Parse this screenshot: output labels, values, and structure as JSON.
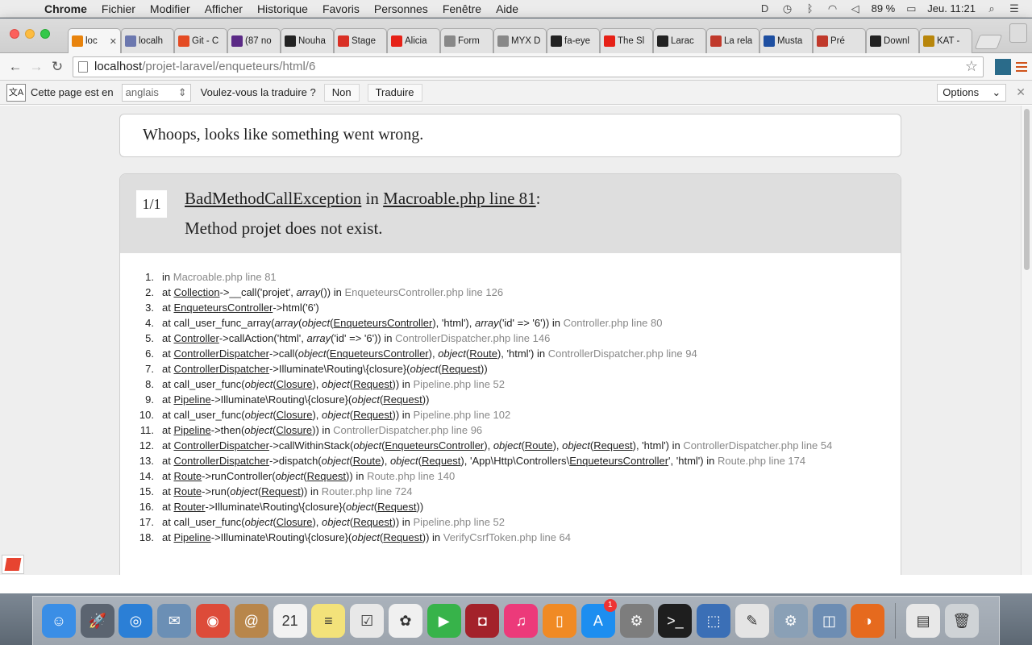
{
  "menubar": {
    "apple": "",
    "items": [
      "Chrome",
      "Fichier",
      "Modifier",
      "Afficher",
      "Historique",
      "Favoris",
      "Personnes",
      "Fenêtre",
      "Aide"
    ],
    "battery": "89 %",
    "clock": "Jeu. 11:21"
  },
  "tabs": [
    {
      "label": "loc",
      "color": "#e8830c",
      "active": true
    },
    {
      "label": "localh",
      "color": "#6c78af"
    },
    {
      "label": "Git - C",
      "color": "#e44b23"
    },
    {
      "label": "(87 no",
      "color": "#5b2a86"
    },
    {
      "label": "Nouha",
      "color": "#222222"
    },
    {
      "label": "Stage",
      "color": "#d93025"
    },
    {
      "label": "Alicia",
      "color": "#e62117"
    },
    {
      "label": "Form",
      "color": "#888888"
    },
    {
      "label": "MYX D",
      "color": "#888888"
    },
    {
      "label": "fa-eye",
      "color": "#222222"
    },
    {
      "label": "The Sl",
      "color": "#e62117"
    },
    {
      "label": "Larac",
      "color": "#222222"
    },
    {
      "label": "La rela",
      "color": "#c0392b"
    },
    {
      "label": "Musta",
      "color": "#1e4fa1"
    },
    {
      "label": "Pré",
      "color": "#c0392b"
    },
    {
      "label": "Downl",
      "color": "#222222"
    },
    {
      "label": "KAT -",
      "color": "#b8860b"
    }
  ],
  "address": {
    "host": "localhost",
    "path": "/projet-laravel/enqueteurs/html/6"
  },
  "translate": {
    "prefix": "Cette page est en",
    "language": "anglais",
    "question": "Voulez-vous la traduire ?",
    "no": "Non",
    "translate": "Traduire",
    "options": "Options"
  },
  "page": {
    "whoops": "Whoops, looks like something went wrong.",
    "counter": "1/1",
    "exception_class": "BadMethodCallException",
    "in_word": "in",
    "exception_file": "Macroable.php line 81",
    "colon": ":",
    "message": "Method projet does not exist."
  },
  "trace": [
    "in Macroable.php line 81",
    "at Collection->__call('projet', array()) in EnqueteursController.php line 126",
    "at EnqueteursController->html('6')",
    "at call_user_func_array(array(object(EnqueteursController), 'html'), array('id' => '6')) in Controller.php line 80",
    "at Controller->callAction('html', array('id' => '6')) in ControllerDispatcher.php line 146",
    "at ControllerDispatcher->call(object(EnqueteursController), object(Route), 'html') in ControllerDispatcher.php line 94",
    "at ControllerDispatcher->Illuminate\\Routing\\{closure}(object(Request))",
    "at call_user_func(object(Closure), object(Request)) in Pipeline.php line 52",
    "at Pipeline->Illuminate\\Routing\\{closure}(object(Request))",
    "at call_user_func(object(Closure), object(Request)) in Pipeline.php line 102",
    "at Pipeline->then(object(Closure)) in ControllerDispatcher.php line 96",
    "at ControllerDispatcher->callWithinStack(object(EnqueteursController), object(Route), object(Request), 'html') in ControllerDispatcher.php line 54",
    "at ControllerDispatcher->dispatch(object(Route), object(Request), 'App\\Http\\Controllers\\EnqueteursController', 'html') in Route.php line 174",
    "at Route->runController(object(Request)) in Route.php line 140",
    "at Route->run(object(Request)) in Router.php line 724",
    "at Router->Illuminate\\Routing\\{closure}(object(Request))",
    "at call_user_func(object(Closure), object(Request)) in Pipeline.php line 52",
    "at Pipeline->Illuminate\\Routing\\{closure}(object(Request)) in VerifyCsrfToken.php line 64"
  ],
  "dock": [
    {
      "name": "finder-icon",
      "color": "#3a8ee6",
      "glyph": "☺"
    },
    {
      "name": "launchpad-icon",
      "color": "#5b6470",
      "glyph": "🚀"
    },
    {
      "name": "safari-icon",
      "color": "#2b7fd6",
      "glyph": "◎"
    },
    {
      "name": "mail-icon",
      "color": "#6b8fb5",
      "glyph": "✉"
    },
    {
      "name": "chrome-icon",
      "color": "#dd4b39",
      "glyph": "◉"
    },
    {
      "name": "contacts-icon",
      "color": "#b8864b",
      "glyph": "@"
    },
    {
      "name": "calendar-icon",
      "color": "#f2f2f2",
      "glyph": "21"
    },
    {
      "name": "notes-icon",
      "color": "#f3e27a",
      "glyph": "≡"
    },
    {
      "name": "reminders-icon",
      "color": "#e8e8e8",
      "glyph": "☑"
    },
    {
      "name": "photos-icon",
      "color": "#f0f0f0",
      "glyph": "✿"
    },
    {
      "name": "facetime-icon",
      "color": "#37b34a",
      "glyph": "▶"
    },
    {
      "name": "photobooth-icon",
      "color": "#a3222a",
      "glyph": "◘"
    },
    {
      "name": "itunes-icon",
      "color": "#ec3a7a",
      "glyph": "♫"
    },
    {
      "name": "ibooks-icon",
      "color": "#f08a24",
      "glyph": "▯"
    },
    {
      "name": "appstore-icon",
      "color": "#1d8ef0",
      "glyph": "A",
      "badge": "1"
    },
    {
      "name": "system-preferences-icon",
      "color": "#7d7d7d",
      "glyph": "⚙"
    },
    {
      "name": "terminal-icon",
      "color": "#1e1e1e",
      "glyph": ">_"
    },
    {
      "name": "virtualbox-icon",
      "color": "#3b6fb6",
      "glyph": "⬚"
    },
    {
      "name": "textedit-icon",
      "color": "#e4e4e4",
      "glyph": "✎"
    },
    {
      "name": "utilities-icon",
      "color": "#8aa0b6",
      "glyph": "⚙"
    },
    {
      "name": "preview-icon",
      "color": "#6d8db3",
      "glyph": "◫"
    },
    {
      "name": "firefox-icon",
      "color": "#e66a1e",
      "glyph": "◑"
    }
  ],
  "dock_right": [
    {
      "name": "downloads-stack-icon",
      "color": "#e8e8e8",
      "glyph": "▤"
    },
    {
      "name": "trash-icon",
      "color": "#cfd3d6",
      "glyph": "🗑"
    }
  ]
}
